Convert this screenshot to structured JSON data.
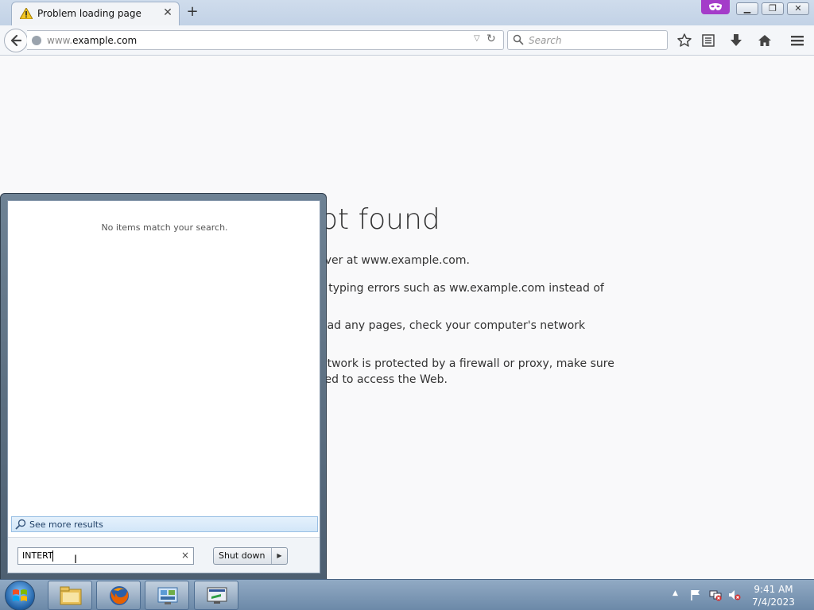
{
  "browser": {
    "tab_title": "Problem loading page",
    "new_tab_label": "+",
    "url_prefix": "www.",
    "url_domain": "example.com",
    "search_placeholder": "Search"
  },
  "error_page": {
    "title": "ot found",
    "line1": "rver at www.example.com.",
    "line2": "r typing errors such as ww.example.com instead of",
    "line3": "oad any pages, check your computer's network",
    "line4": "etwork is protected by a firewall or proxy, make sure",
    "line5": "ted to access the Web."
  },
  "start_menu": {
    "no_items_text": "No items match your search.",
    "see_more_label": "See more results",
    "search_value": "INTERT",
    "shutdown_label": "Shut down"
  },
  "taskbar": {
    "time": "9:41 AM",
    "date": "7/4/2023"
  },
  "icons": {
    "tab": "warning-icon",
    "private": "private-browsing-mask-icon",
    "toolbar": [
      "bookmark-star-icon",
      "reading-list-icon",
      "downloads-icon",
      "home-icon",
      "menu-icon"
    ],
    "taskbar": [
      "windows-explorer-icon",
      "firefox-icon",
      "control-panel-icon",
      "remote-desktop-icon"
    ]
  },
  "colors": {
    "private_accent": "#a43cc9",
    "taskbar_bg": "#7f9bb8",
    "page_bg": "#f9f9fa"
  }
}
